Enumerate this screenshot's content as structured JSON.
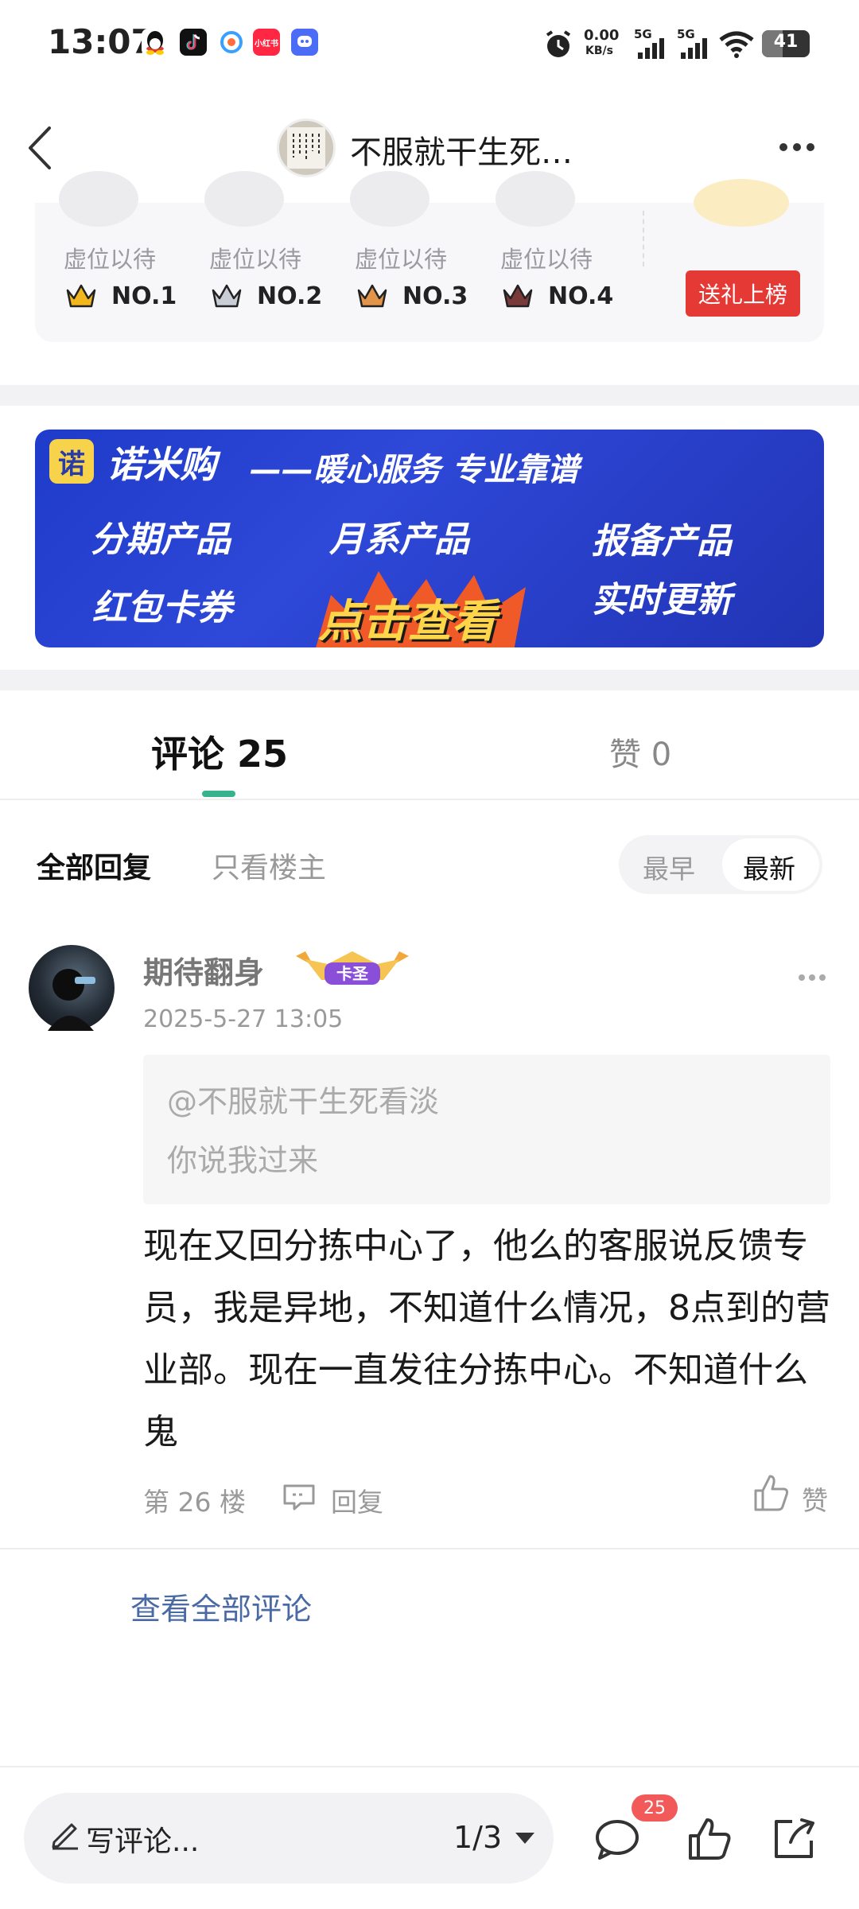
{
  "status_bar": {
    "time": "13:07",
    "app_icons": [
      "qq-icon",
      "tiktok-icon",
      "browser-icon",
      "xiaohongshu-icon",
      "chat-icon"
    ],
    "app_icon_colors": [
      "#ffcc00",
      "#111111",
      "#39a0ff",
      "#ff2742",
      "#4a6cf7"
    ],
    "xhs_label": "小红书",
    "net_speed": "0.00",
    "net_unit": "KB/s",
    "signal_1": "5G",
    "signal_2": "5G",
    "battery": "41"
  },
  "header": {
    "title": "不服就干生死…",
    "avatar_icon": "calligraphy-avatar-icon",
    "more_icon": "more-icon"
  },
  "ranking": {
    "slots": [
      {
        "name": "虚位以待",
        "rank": "NO.1",
        "crown_color": "#f2b61f"
      },
      {
        "name": "虚位以待",
        "rank": "NO.2",
        "crown_color": "#c9cdd6"
      },
      {
        "name": "虚位以待",
        "rank": "NO.3",
        "crown_color": "#e2944a"
      },
      {
        "name": "虚位以待",
        "rank": "NO.4",
        "crown_color": "#7a3a3a"
      }
    ],
    "gift_button": "送礼上榜"
  },
  "banner": {
    "logo": "诺",
    "brand": "诺米购",
    "slogan": "——暖心服务 专业靠谱",
    "items": [
      "分期产品",
      "月系产品",
      "报备产品",
      "红包卡券",
      "实时更新"
    ],
    "cta": "点击查看"
  },
  "tabs": {
    "comments": "评论 25",
    "likes": "赞 0",
    "accent": "#36b28c"
  },
  "filters": {
    "all": "全部回复",
    "op_only": "只看楼主",
    "sort_early": "最早",
    "sort_new": "最新"
  },
  "comment": {
    "username": "期待翻身",
    "badge": "卡圣",
    "time": "2025-5-27 13:05",
    "quote_at": "@不服就干生死看淡",
    "quote_text": "你说我过来",
    "body": "现在又回分拣中心了，他么的客服说反馈专员，我是异地，不知道什么情况，8点到的营业部。现在一直发往分拣中心。不知道什么鬼",
    "floor": "第 26 楼",
    "reply": "回复",
    "like": "赞"
  },
  "view_all": "查看全部评论",
  "bottom_bar": {
    "write_placeholder": "写评论...",
    "page": "1/3",
    "comment_count": "25"
  }
}
